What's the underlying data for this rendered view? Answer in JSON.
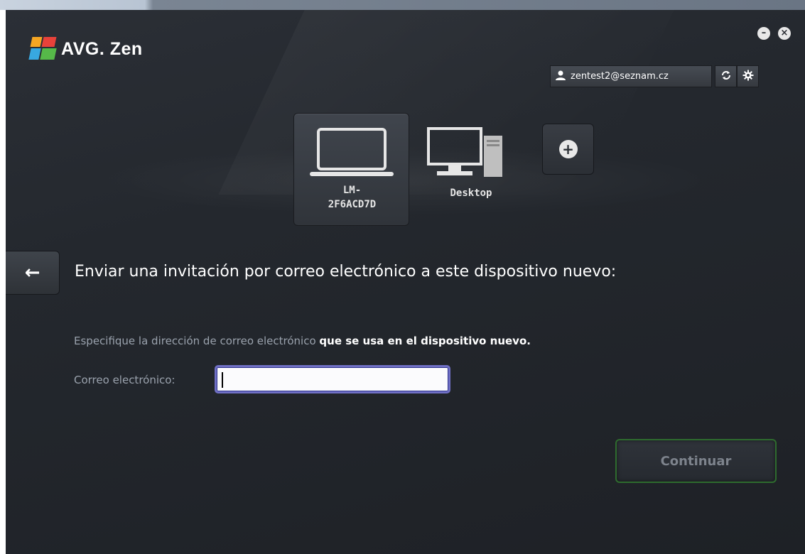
{
  "app": {
    "title": "AVG. Zen"
  },
  "window_controls": {
    "minimize": "–",
    "close": "×"
  },
  "account": {
    "email": "zentest2@seznam.cz"
  },
  "devices": [
    {
      "label_line1": "LM-",
      "label_line2": "2F6ACD7D",
      "type": "laptop",
      "selected": true
    },
    {
      "label_line1": "Desktop",
      "label_line2": "",
      "type": "desktop",
      "selected": false
    }
  ],
  "add_device": {
    "symbol": "+"
  },
  "back": {
    "symbol": "←"
  },
  "invite": {
    "heading": "Enviar una invitación por correo electrónico a este dispositivo nuevo:",
    "instruction_plain": "Especifique la dirección de correo electrónico ",
    "instruction_bold": "que se usa en el dispositivo nuevo.",
    "email_label": "Correo electrónico:",
    "email_value": "",
    "continue_label": "Continuar"
  },
  "colors": {
    "accent_green": "#2e6b2e",
    "input_focus": "#6f6fc4",
    "background": "#24282e"
  }
}
